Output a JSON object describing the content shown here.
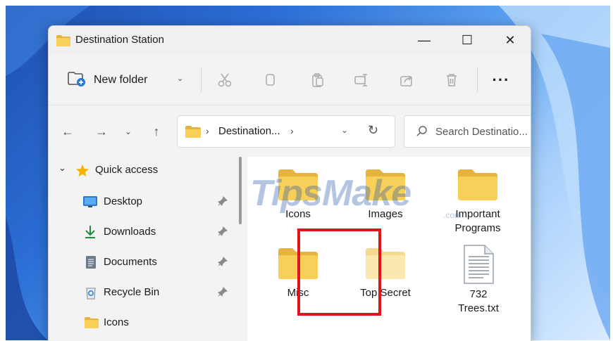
{
  "window": {
    "title": "Destination Station",
    "minimize_glyph": "—",
    "maximize_glyph": "☐",
    "close_glyph": "✕"
  },
  "toolbar": {
    "new_folder_label": "New folder",
    "new_folder_chevron": "⌄",
    "more_label": "···",
    "icons": [
      "cut-icon",
      "copy-icon",
      "paste-icon",
      "rename-icon",
      "share-icon",
      "delete-icon"
    ]
  },
  "navigation": {
    "back_glyph": "←",
    "forward_glyph": "→",
    "recent_glyph": "⌄",
    "up_glyph": "↑"
  },
  "address_bar": {
    "separator": "›",
    "path_label": "Destination...",
    "dropdown_glyph": "⌄",
    "refresh_glyph": "↻"
  },
  "search": {
    "placeholder": "Search Destinatio..."
  },
  "nav_pane": {
    "quick_access_label": "Quick access",
    "expand_glyph": "⌄",
    "items": [
      {
        "label": "Desktop",
        "pinned": true
      },
      {
        "label": "Downloads",
        "pinned": true
      },
      {
        "label": "Documents",
        "pinned": true
      },
      {
        "label": "Recycle Bin",
        "pinned": true
      },
      {
        "label": "Icons",
        "pinned": false
      }
    ]
  },
  "content": {
    "items": [
      {
        "label": "Icons",
        "type": "folder"
      },
      {
        "label": "Images",
        "type": "folder"
      },
      {
        "label": "Important Programs",
        "type": "folder"
      },
      {
        "label": "Misc",
        "type": "folder"
      },
      {
        "label": "Top Secret",
        "type": "folder",
        "highlighted": true
      },
      {
        "label": "732 Trees.txt",
        "type": "text-file"
      }
    ]
  },
  "watermark": {
    "text": "TipsMake",
    "suffix": ".com"
  },
  "colors": {
    "folder_yellow": "#f8cf58",
    "folder_tab": "#e6b43c",
    "highlight_red": "#e0151b",
    "accent_blue": "#2b79d0"
  }
}
